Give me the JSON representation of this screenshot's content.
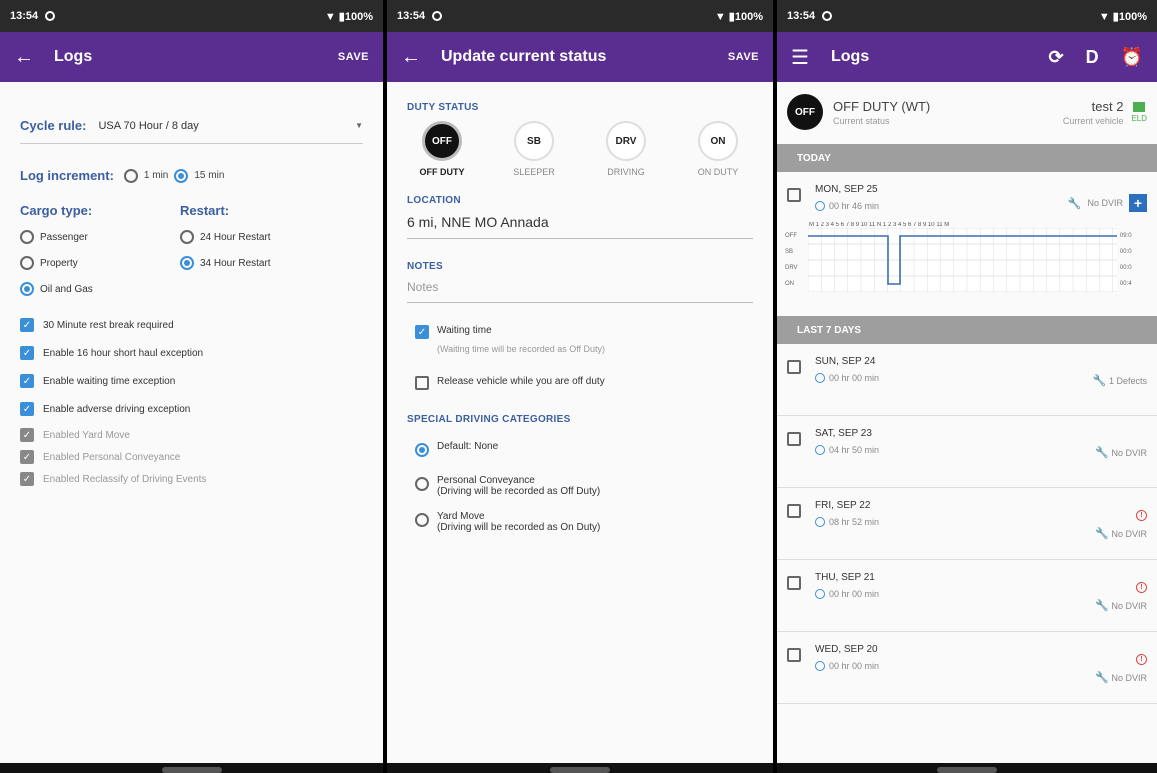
{
  "status_bar": {
    "time": "13:54",
    "battery": "100%"
  },
  "screen1": {
    "title": "Logs",
    "save": "SAVE",
    "cycle_label": "Cycle rule:",
    "cycle_value": "USA 70 Hour / 8 day",
    "log_increment_label": "Log increment:",
    "inc_1": "1 min",
    "inc_15": "15 min",
    "cargo_label": "Cargo type:",
    "restart_label": "Restart:",
    "cargo_passenger": "Passenger",
    "cargo_property": "Property",
    "cargo_oil": "Oil and Gas",
    "restart_24": "24 Hour Restart",
    "restart_34": "34 Hour Restart",
    "opt_rest_break": "30 Minute rest break required",
    "opt_16_hour": "Enable 16 hour short haul exception",
    "opt_waiting": "Enable waiting time exception",
    "opt_adverse": "Enable adverse driving exception",
    "opt_yard": "Enabled Yard Move",
    "opt_pc": "Enabled Personal Conveyance",
    "opt_reclassify": "Enabled Reclassify of Driving Events"
  },
  "screen2": {
    "title": "Update current status",
    "save": "SAVE",
    "duty_status_label": "DUTY STATUS",
    "duty": [
      {
        "code": "OFF",
        "label": "OFF DUTY"
      },
      {
        "code": "SB",
        "label": "SLEEPER"
      },
      {
        "code": "DRV",
        "label": "DRIVING"
      },
      {
        "code": "ON",
        "label": "ON DUTY"
      }
    ],
    "location_label": "LOCATION",
    "location_value": "6 mi, NNE MO Annada",
    "notes_label": "NOTES",
    "notes_placeholder": "Notes",
    "waiting_time": "Waiting time",
    "waiting_time_sub": "(Waiting time will be recorded as Off Duty)",
    "release_vehicle": "Release vehicle while you are off duty",
    "special_label": "SPECIAL DRIVING CATEGORIES",
    "cat_default": "Default: None",
    "cat_pc": "Personal Conveyance",
    "cat_pc_sub": "(Driving will be recorded as Off Duty)",
    "cat_yard": "Yard Move",
    "cat_yard_sub": "(Driving will be recorded as On Duty)"
  },
  "screen3": {
    "title": "Logs",
    "status_badge": "OFF",
    "status_text": "OFF DUTY (WT)",
    "status_sub": "Current status",
    "vehicle": "test 2",
    "vehicle_sub": "Current vehicle",
    "eld_label": "ELD",
    "d_label": "D",
    "today_label": "TODAY",
    "today": {
      "date": "MON, SEP 25",
      "dur": "00 hr 46 min",
      "dvir": "No DVIR"
    },
    "grid_rows": [
      "OFF",
      "SB",
      "DRV",
      "ON"
    ],
    "grid_hours": "M 1 2 3 4 5 6 7 8 9 10 11 N 1 2 3 4 5 6 7 8 9 10 11 M",
    "grid_totals": [
      "09:0",
      "00:0",
      "00:0",
      "00:4"
    ],
    "last7_label": "LAST 7 DAYS",
    "days": [
      {
        "date": "SUN, SEP 24",
        "dur": "00 hr 00 min",
        "dvir": "1 Defects",
        "alert": false
      },
      {
        "date": "SAT, SEP 23",
        "dur": "04 hr 50 min",
        "dvir": "No DVIR",
        "alert": false
      },
      {
        "date": "FRI, SEP 22",
        "dur": "08 hr 52 min",
        "dvir": "No DVIR",
        "alert": true
      },
      {
        "date": "THU, SEP 21",
        "dur": "00 hr 00 min",
        "dvir": "No DVIR",
        "alert": true
      },
      {
        "date": "WED, SEP 20",
        "dur": "00 hr 00 min",
        "dvir": "No DVIR",
        "alert": true
      }
    ]
  },
  "colors": {
    "appbar": "#5a2d91",
    "accent": "#3b8fd9",
    "label_blue": "#3b5fa0"
  }
}
